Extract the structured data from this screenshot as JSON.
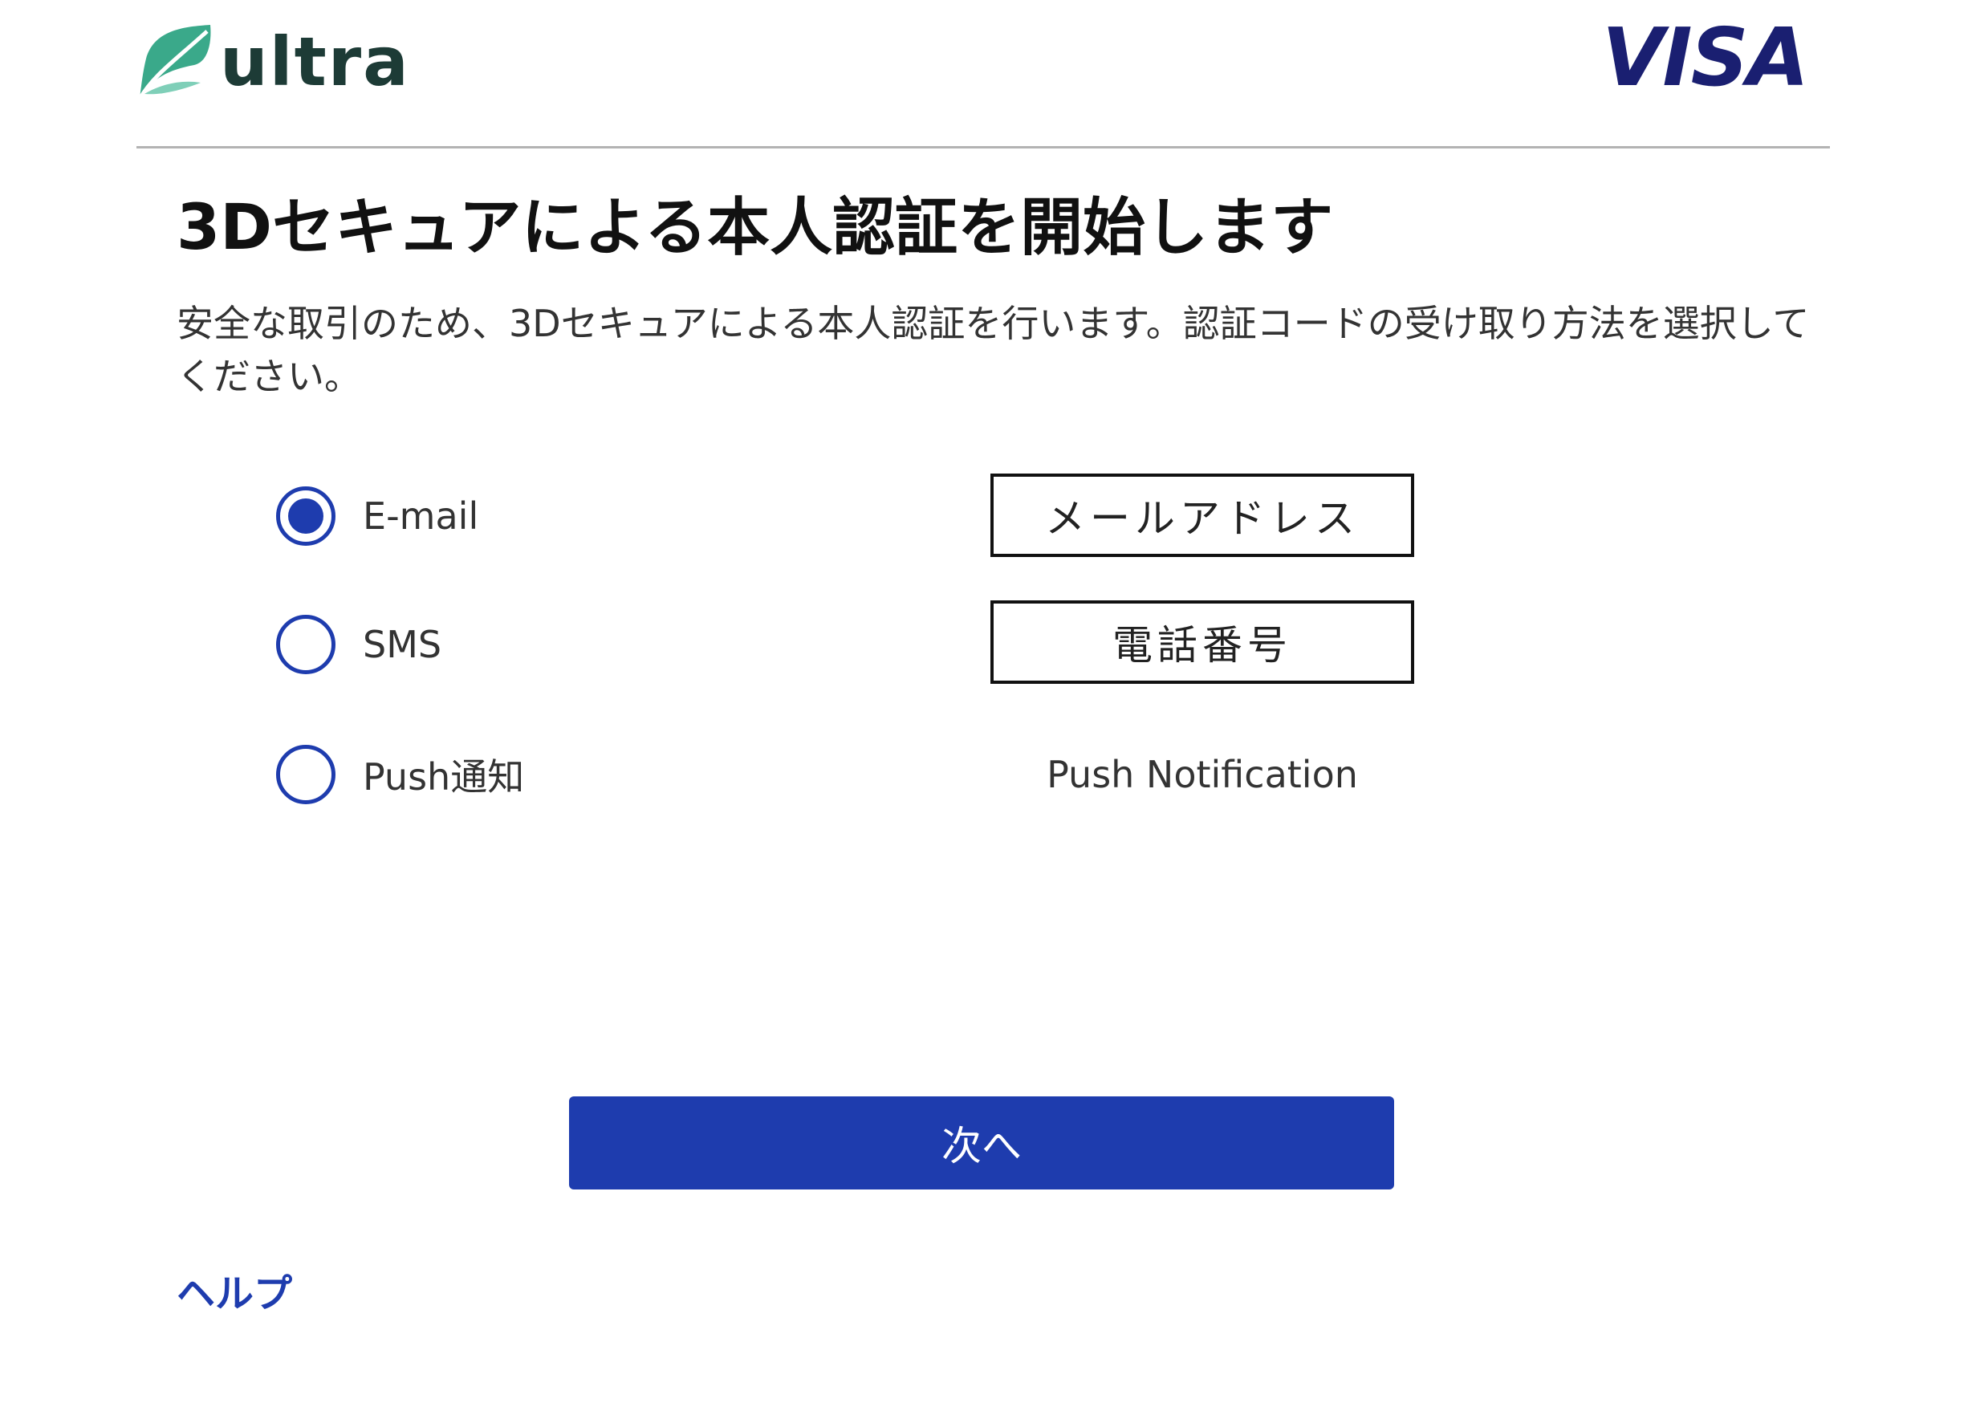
{
  "header": {
    "logo_text": "ultra",
    "brand_text": "VISA"
  },
  "main": {
    "title": "3Dセキュアによる本人認証を開始します",
    "description": "安全な取引のため、3Dセキュアによる本人認証を行います。認証コードの受け取り方法を選択してください。"
  },
  "options": [
    {
      "label": "E-mail",
      "selected": true,
      "detail": "メールアドレス"
    },
    {
      "label": "SMS",
      "selected": false,
      "detail": "電話番号"
    },
    {
      "label": "Push通知",
      "selected": false,
      "detail": "Push Notification"
    }
  ],
  "actions": {
    "next_label": "次へ",
    "help_label": "ヘルプ"
  },
  "colors": {
    "accent": "#1e3cae",
    "visa_navy": "#1a1f71",
    "logo_green": "#3aa98a",
    "logo_text": "#1d3b36",
    "divider": "#b3b3b3"
  },
  "icons": {
    "logo": "leaf-logo-icon",
    "radio": "radio-button-icon"
  }
}
